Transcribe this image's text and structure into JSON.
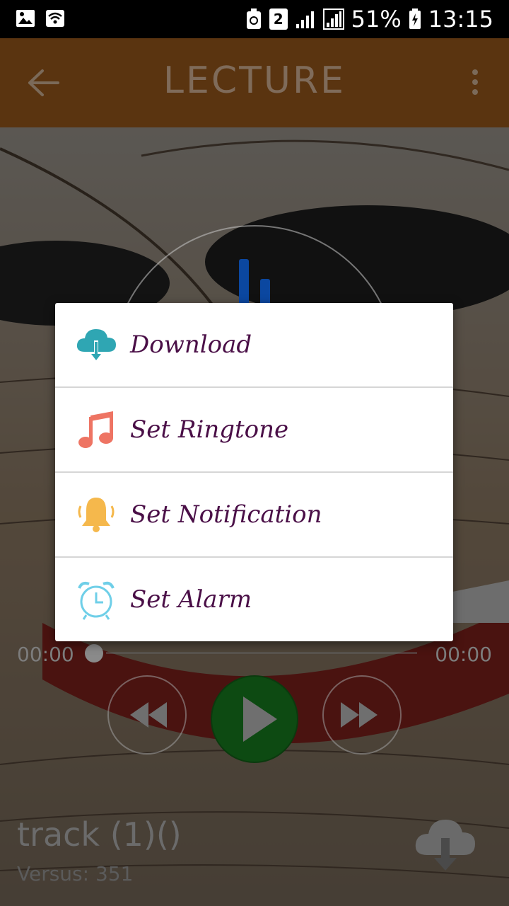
{
  "status_bar": {
    "sim_slot": "2",
    "battery": "51%",
    "time": "13:15"
  },
  "app_bar": {
    "title": "LECTURE"
  },
  "player": {
    "elapsed": "00:00",
    "duration": "00:00",
    "track_title": "track (1)()",
    "track_subtitle": "Versus: 351"
  },
  "menu": {
    "items": [
      {
        "label": "Download",
        "icon": "cloud-download-icon"
      },
      {
        "label": "Set Ringtone",
        "icon": "music-note-icon"
      },
      {
        "label": "Set Notification",
        "icon": "bell-icon"
      },
      {
        "label": "Set Alarm",
        "icon": "alarm-clock-icon"
      }
    ]
  },
  "colors": {
    "app_bar": "#5a3410",
    "menu_text": "#4a0f47",
    "play_button": "#0d4a12"
  }
}
